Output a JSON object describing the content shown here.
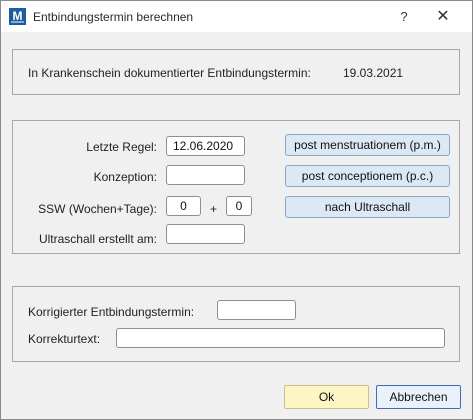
{
  "window": {
    "title": "Entbindungstermin berechnen",
    "help_glyph": "?",
    "close_glyph": "✕",
    "app_icon_letter": "M"
  },
  "top_panel": {
    "text": "In Krankenschein dokumentierter Entbindungstermin:",
    "date": "19.03.2021"
  },
  "form": {
    "letzte_regel_label": "Letzte Regel:",
    "letzte_regel_value": "12.06.2020",
    "konzeption_label": "Konzeption:",
    "konzeption_value": "",
    "ssw_label": "SSW (Wochen+Tage):",
    "ssw_weeks": "0",
    "ssw_plus": "+",
    "ssw_days": "0",
    "ultraschall_label": "Ultraschall erstellt am:",
    "ultraschall_value": ""
  },
  "calc_buttons": {
    "pm": "post menstruationem (p.m.)",
    "pc": "post conceptionem (p.c.)",
    "us": "nach Ultraschall"
  },
  "bottom_panel": {
    "korrigiert_label": "Korrigierter Entbindungstermin:",
    "korrigiert_value": "",
    "korrekturtext_label": "Korrekturtext:",
    "korrekturtext_value": ""
  },
  "footer": {
    "ok": "Ok",
    "cancel": "Abbrechen"
  },
  "colors": {
    "ok_bg": "#fdf5c4",
    "calc_button_bg": "#dde8f5",
    "cancel_border": "#3d6fb6",
    "app_icon": "#1f5c9e"
  },
  "icons": {
    "app": "medistar-app-icon",
    "help": "help-icon",
    "close": "close-icon"
  }
}
